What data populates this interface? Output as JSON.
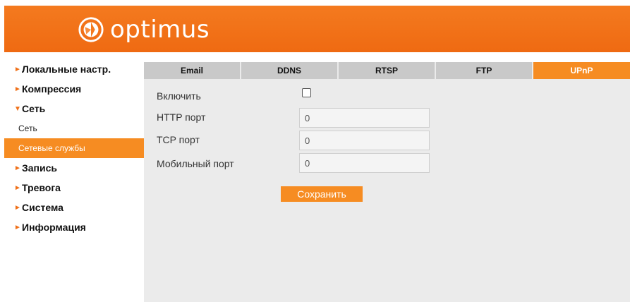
{
  "header": {
    "brand": "optimus"
  },
  "sidebar": {
    "items": [
      {
        "label": "Локальные настр.",
        "expanded": false
      },
      {
        "label": "Компрессия",
        "expanded": false
      },
      {
        "label": "Сеть",
        "expanded": true,
        "children": [
          {
            "label": "Сеть",
            "active": false
          },
          {
            "label": "Сетевые службы",
            "active": true
          }
        ]
      },
      {
        "label": "Запись",
        "expanded": false
      },
      {
        "label": "Тревога",
        "expanded": false
      },
      {
        "label": "Система",
        "expanded": false
      },
      {
        "label": "Информация",
        "expanded": false
      }
    ]
  },
  "tabs": [
    {
      "label": "Email",
      "active": false
    },
    {
      "label": "DDNS",
      "active": false
    },
    {
      "label": "RTSP",
      "active": false
    },
    {
      "label": "FTP",
      "active": false
    },
    {
      "label": "UPnP",
      "active": true
    }
  ],
  "form": {
    "enable_label": "Включить",
    "enable_checked": false,
    "http_port_label": "HTTP порт",
    "http_port_value": "0",
    "tcp_port_label": "TCP порт",
    "tcp_port_value": "0",
    "mobile_port_label": "Мобильный порт",
    "mobile_port_value": "0",
    "save_label": "Сохранить"
  },
  "colors": {
    "accent": "#f68c22",
    "header": "#f47a1f",
    "content_bg": "#ebebeb",
    "tab_bg": "#c9c9c9"
  },
  "icons": {
    "collapsed_arrow": "►",
    "expanded_arrow": "▼"
  }
}
